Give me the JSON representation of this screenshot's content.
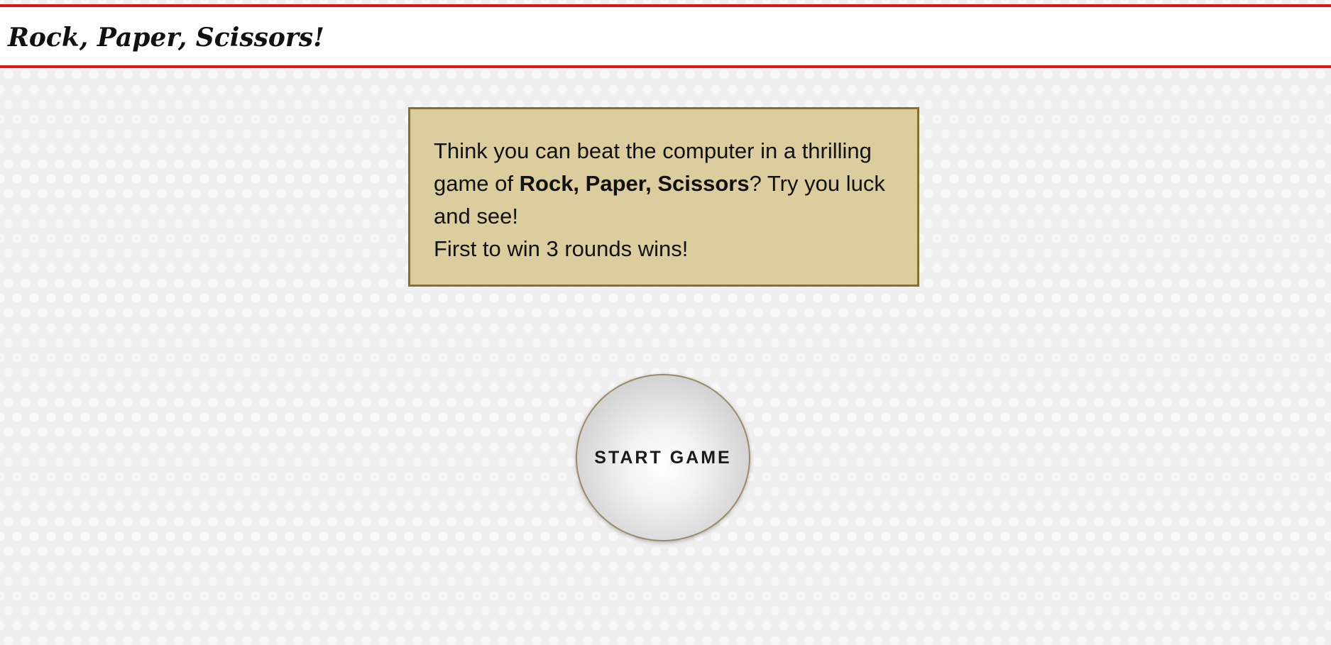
{
  "header": {
    "title": "Rock, Paper, Scissors!"
  },
  "intro": {
    "line1_pre": "Think you can beat the computer in a thrilling game of ",
    "game_name": "Rock, Paper, Scissors",
    "line1_post": "? Try you luck and see!",
    "line2": "First to win 3 rounds wins!"
  },
  "start_button": {
    "label": "START GAME"
  },
  "colors": {
    "header_border": "#de1515",
    "intro_background": "#dbcd9e",
    "intro_border": "#8a6f2a"
  }
}
